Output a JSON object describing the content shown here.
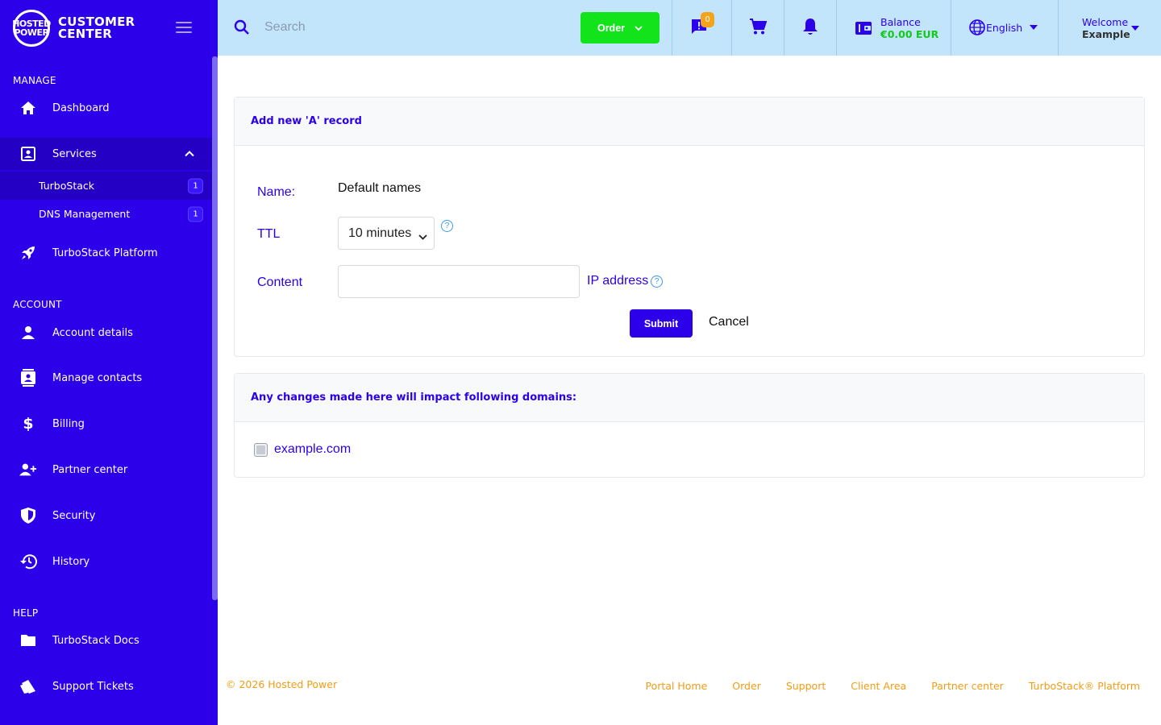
{
  "brand": {
    "logo_mark": "HOSTED POWER",
    "name_line1": "CUSTOMER",
    "name_line2": "CENTER"
  },
  "sidebar": {
    "sections": {
      "manage": "MANAGE",
      "account": "ACCOUNT",
      "help": "HELP"
    },
    "items": {
      "dashboard": "Dashboard",
      "services": "Services",
      "turbostack": "TurboStack",
      "turbostack_count": "1",
      "dns_management": "DNS Management",
      "dns_count": "1",
      "turbostack_platform": "TurboStack Platform",
      "account_details": "Account details",
      "manage_contacts": "Manage contacts",
      "billing": "Billing",
      "partner_center": "Partner center",
      "security": "Security",
      "history": "History",
      "turbostack_docs": "TurboStack Docs",
      "support_tickets": "Support Tickets"
    }
  },
  "topbar": {
    "search_placeholder": "Search",
    "order_label": "Order",
    "chat_badge": "0",
    "balance_label": "Balance",
    "balance_value": "€0.00 EUR",
    "language": "English",
    "welcome_label": "Welcome",
    "welcome_user": "Example"
  },
  "record_form": {
    "title": "Add new 'A' record",
    "name_label": "Name:",
    "name_value": "Default names",
    "ttl_label": "TTL",
    "ttl_selected": "10 minutes",
    "ttl_help": "?",
    "content_label": "Content",
    "content_value": "",
    "ip_label": "IP address",
    "ip_help": "?",
    "submit_label": "Submit",
    "cancel_label": "Cancel"
  },
  "domains_card": {
    "title": "Any changes made here will impact following domains:",
    "domains": [
      "example.com"
    ]
  },
  "footer": {
    "copyright": "© 2026 Hosted Power",
    "links": [
      "Portal Home",
      "Order",
      "Support",
      "Client Area",
      "Partner center",
      "TurboStack® Platform"
    ]
  },
  "colors": {
    "brand_primary": "#2c00e8",
    "topbar_bg": "#c3e5fb",
    "order_green": "#13e31b",
    "footer_orange": "#f39c12",
    "badge_orange": "#f5a31a"
  }
}
